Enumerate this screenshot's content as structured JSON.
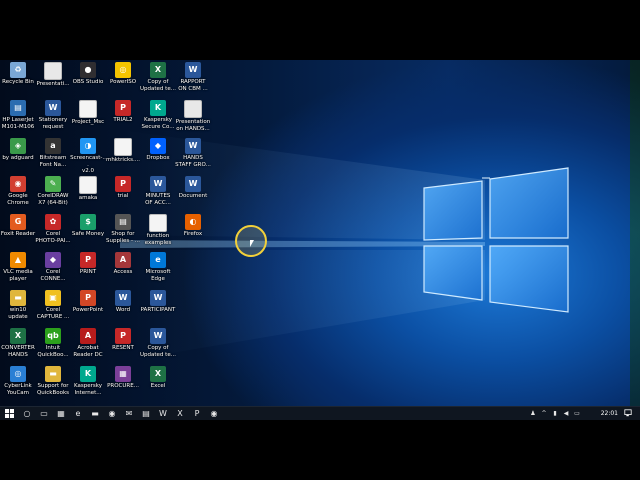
{
  "desktop": {
    "icons": [
      {
        "label": "Recycle Bin",
        "icon": "recycle-bin-icon",
        "color": "#7aa7d6",
        "glyph": "♻"
      },
      {
        "label": "HP LaserJet\nM101-M106",
        "icon": "printer-icon",
        "color": "#2b6cb0",
        "glyph": "▤"
      },
      {
        "label": "by adguard",
        "icon": "shield-icon",
        "color": "#3a9a4a",
        "glyph": "◈"
      },
      {
        "label": "Google\nChrome",
        "icon": "chrome-icon",
        "color": "#d23f31",
        "glyph": "◉"
      },
      {
        "label": "Foxit Reader",
        "icon": "foxit-icon",
        "color": "#e35b1f",
        "glyph": "G"
      },
      {
        "label": "VLC media\nplayer",
        "icon": "vlc-cone-icon",
        "color": "#f08a00",
        "glyph": "▲"
      },
      {
        "label": "win10 update",
        "icon": "folder-icon",
        "color": "#e0b63c",
        "glyph": "▬"
      },
      {
        "label": "CONVERTER\nHANDS",
        "icon": "excel-file-icon",
        "color": "#1e7145",
        "glyph": "X"
      },
      {
        "label": "CyberLink\nYouCam",
        "icon": "youcam-icon",
        "color": "#2a7fd4",
        "glyph": "◎"
      },
      {
        "label": "Presentati...",
        "icon": "presentation-icon",
        "color": "#e8e8e8",
        "glyph": ""
      },
      {
        "label": "Stationery\nrequest",
        "icon": "word-doc-icon",
        "color": "#2b579a",
        "glyph": "W"
      },
      {
        "label": "Bitstream\nFont Na...",
        "icon": "font-navigator-icon",
        "color": "#333333",
        "glyph": "a"
      },
      {
        "label": "CorelDRAW\nX7 (64-Bit)",
        "icon": "coreldraw-icon",
        "color": "#4caf50",
        "glyph": "✎"
      },
      {
        "label": "Corel\nPHOTO-PAI...",
        "icon": "corel-photopaint-icon",
        "color": "#c62828",
        "glyph": "✿"
      },
      {
        "label": "Corel\nCONNE...",
        "icon": "corel-connect-icon",
        "color": "#6a3fa0",
        "glyph": "◆"
      },
      {
        "label": "Corel\nCAPTURE ...",
        "icon": "corel-capture-icon",
        "color": "#f0c020",
        "glyph": "▣"
      },
      {
        "label": "Intuit\nQuickBoo...",
        "icon": "quickbooks-icon",
        "color": "#2ca01c",
        "glyph": "qb"
      },
      {
        "label": "Support for\nQuickBooks",
        "icon": "folder-icon",
        "color": "#e0b63c",
        "glyph": "▬"
      },
      {
        "label": "OBS Studio",
        "icon": "obs-icon",
        "color": "#302e31",
        "glyph": "●"
      },
      {
        "label": "Project_Msc",
        "icon": "text-file-icon",
        "color": "#f4f4f4",
        "glyph": ""
      },
      {
        "label": "Screencast-...\nv2.0",
        "icon": "screencast-icon",
        "color": "#2196f3",
        "glyph": "◑"
      },
      {
        "label": "amaka",
        "icon": "document-icon",
        "color": "#f4f4f4",
        "glyph": ""
      },
      {
        "label": "Safe Money",
        "icon": "safe-money-icon",
        "color": "#1a9f6a",
        "glyph": "$"
      },
      {
        "label": "PRINT",
        "icon": "pdf-icon",
        "color": "#c62828",
        "glyph": "P"
      },
      {
        "label": "PowerPoint",
        "icon": "powerpoint-icon",
        "color": "#d24726",
        "glyph": "P"
      },
      {
        "label": "Acrobat\nReader DC",
        "icon": "acrobat-icon",
        "color": "#b71c1c",
        "glyph": "A"
      },
      {
        "label": "Kaspersky\nInternet...",
        "icon": "kaspersky-icon",
        "color": "#00a88e",
        "glyph": "K"
      },
      {
        "label": "PowerISO",
        "icon": "poweriso-icon",
        "color": "#f5c400",
        "glyph": "◎"
      },
      {
        "label": "TRIAL2",
        "icon": "pdf-icon",
        "color": "#c62828",
        "glyph": "P"
      },
      {
        "label": "mhktricks....",
        "icon": "document-icon",
        "color": "#f4f4f4",
        "glyph": ""
      },
      {
        "label": "trial",
        "icon": "pdf-icon",
        "color": "#c62828",
        "glyph": "P"
      },
      {
        "label": "Shop for\nSupplies - ...",
        "icon": "printer-icon",
        "color": "#555555",
        "glyph": "▤"
      },
      {
        "label": "Access",
        "icon": "access-icon",
        "color": "#a4373a",
        "glyph": "A"
      },
      {
        "label": "Word",
        "icon": "word-icon",
        "color": "#2b579a",
        "glyph": "W"
      },
      {
        "label": "RESENT",
        "icon": "pdf-icon",
        "color": "#c62828",
        "glyph": "P"
      },
      {
        "label": "PROCURE...",
        "icon": "winrar-icon",
        "color": "#7b3f98",
        "glyph": "▦"
      },
      {
        "label": "Copy of\nUpdated te...",
        "icon": "excel-file-icon",
        "color": "#1e7145",
        "glyph": "X"
      },
      {
        "label": "Kaspersky\nSecure Co...",
        "icon": "kaspersky-secure-icon",
        "color": "#00a88e",
        "glyph": "K"
      },
      {
        "label": "Dropbox",
        "icon": "dropbox-icon",
        "color": "#0061fe",
        "glyph": "◆"
      },
      {
        "label": "MINUTES\nOF ACC...",
        "icon": "word-doc-icon",
        "color": "#2b579a",
        "glyph": "W"
      },
      {
        "label": "function\nexamples",
        "icon": "text-file-icon",
        "color": "#f4f4f4",
        "glyph": ""
      },
      {
        "label": "Microsoft\nEdge",
        "icon": "edge-icon",
        "color": "#0078d7",
        "glyph": "e"
      },
      {
        "label": "PARTICIPANT",
        "icon": "word-doc-icon",
        "color": "#2b579a",
        "glyph": "W"
      },
      {
        "label": "Copy of\nUpdated te...",
        "icon": "word-doc-icon",
        "color": "#2b579a",
        "glyph": "W"
      },
      {
        "label": "Excel",
        "icon": "excel-icon",
        "color": "#1e7145",
        "glyph": "X"
      },
      {
        "label": "RAPPORT\nON CBM ...",
        "icon": "word-doc-icon",
        "color": "#2b579a",
        "glyph": "W"
      },
      {
        "label": "Presentation\non HANDS...",
        "icon": "presentation-icon",
        "color": "#e8e8e8",
        "glyph": ""
      },
      {
        "label": "HANDS\nSTAFF GRO...",
        "icon": "word-doc-icon",
        "color": "#2b579a",
        "glyph": "W"
      },
      {
        "label": "Document",
        "icon": "word-doc-icon",
        "color": "#2b579a",
        "glyph": "W"
      },
      {
        "label": "Firefox",
        "icon": "firefox-icon",
        "color": "#e66000",
        "glyph": "◐"
      }
    ]
  },
  "taskbar": {
    "start_icon": "windows-logo-icon",
    "buttons": [
      {
        "name": "cortana-search-icon",
        "glyph": "○"
      },
      {
        "name": "task-view-icon",
        "glyph": "▭"
      },
      {
        "name": "calculator-icon",
        "glyph": "▦"
      },
      {
        "name": "edge-taskbar-icon",
        "glyph": "e"
      },
      {
        "name": "file-explorer-icon",
        "glyph": "▬"
      },
      {
        "name": "chrome-taskbar-icon",
        "glyph": "◉"
      },
      {
        "name": "mail-icon",
        "glyph": "✉"
      },
      {
        "name": "store-icon",
        "glyph": "▤"
      },
      {
        "name": "word-taskbar-icon",
        "glyph": "W"
      },
      {
        "name": "excel-taskbar-icon",
        "glyph": "X"
      },
      {
        "name": "powerpoint-taskbar-icon",
        "glyph": "P"
      },
      {
        "name": "screen-recorder-icon",
        "glyph": "◉"
      }
    ],
    "tray": [
      {
        "name": "people-icon",
        "glyph": "♟"
      },
      {
        "name": "show-hidden-icons-chevron",
        "glyph": "^"
      },
      {
        "name": "network-icon",
        "glyph": "▮"
      },
      {
        "name": "volume-icon",
        "glyph": "◀"
      },
      {
        "name": "language-icon",
        "glyph": "▭"
      }
    ],
    "clock": "22:01",
    "notifications_icon": "action-center-icon"
  }
}
